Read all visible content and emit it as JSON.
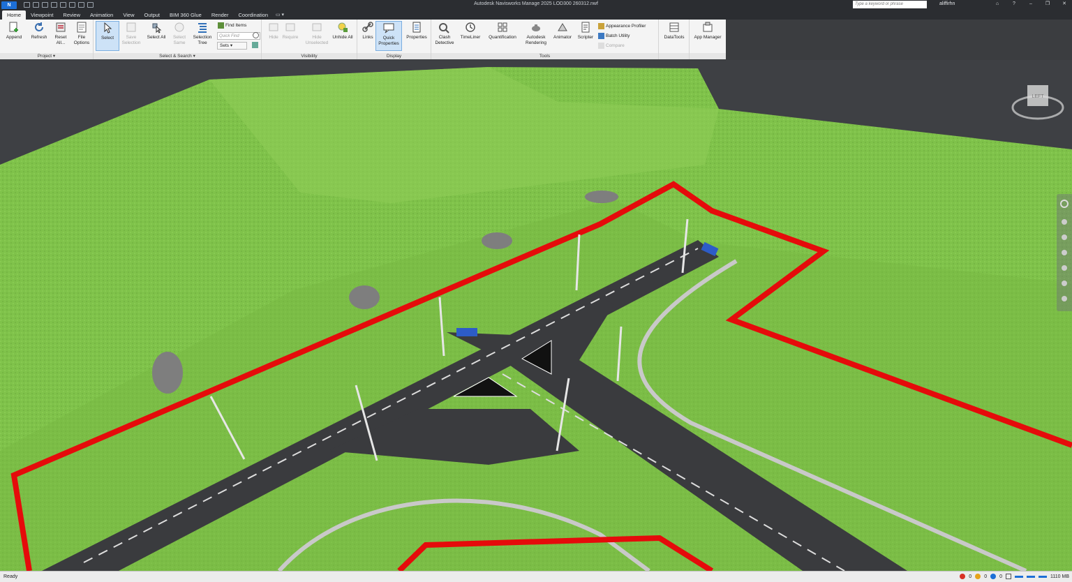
{
  "window": {
    "logo_text": "N",
    "title": "Autodesk Navisworks Manage 2025    LOD300 260312.nwf",
    "search_placeholder": "Type a keyword or phrase",
    "user": "aliffirhn"
  },
  "tabs": [
    {
      "label": "Home",
      "active": true
    },
    {
      "label": "Viewpoint"
    },
    {
      "label": "Review"
    },
    {
      "label": "Animation"
    },
    {
      "label": "View"
    },
    {
      "label": "Output"
    },
    {
      "label": "BIM 360 Glue"
    },
    {
      "label": "Render"
    },
    {
      "label": "Coordination"
    }
  ],
  "ribbon": {
    "project": {
      "label": "Project ▾",
      "append": "Append",
      "refresh": "Refresh",
      "reset_all": "Reset All...",
      "file_options": "File Options"
    },
    "select_search": {
      "label": "Select & Search ▾",
      "select": "Select",
      "save_selection": "Save Selection",
      "select_all": "Select All",
      "select_same": "Select Same",
      "selection_tree": "Selection Tree",
      "find_items": "Find Items",
      "quick_find_placeholder": "Quick Find",
      "sets": "Sets"
    },
    "visibility": {
      "label": "Visibility",
      "hide": "Hide",
      "require": "Require",
      "hide_unselected": "Hide Unselected",
      "unhide_all": "Unhide All"
    },
    "display": {
      "label": "Display",
      "links": "Links",
      "quick_properties": "Quick Properties",
      "properties": "Properties"
    },
    "tools": {
      "label": "Tools",
      "clash_detective": "Clash Detective",
      "timeliner": "TimeLiner",
      "quantification": "Quantification",
      "autodesk_rendering": "Autodesk Rendering",
      "animator": "Animator",
      "scripter": "Scripter",
      "appearance_profiler": "Appearance Profiler",
      "batch_utility": "Batch Utility",
      "compare": "Compare",
      "datatools": "DataTools",
      "app_manager": "App Manager"
    }
  },
  "viewcube": {
    "face": "LEFT"
  },
  "status": {
    "text": "Ready",
    "counts": [
      "0",
      "0",
      "0"
    ],
    "memory": "1110 MB"
  },
  "colors": {
    "grass": "#7fc24a",
    "road": "#3a3b3e",
    "boundary": "#e50b0b",
    "accent": "#1d6fd6"
  }
}
